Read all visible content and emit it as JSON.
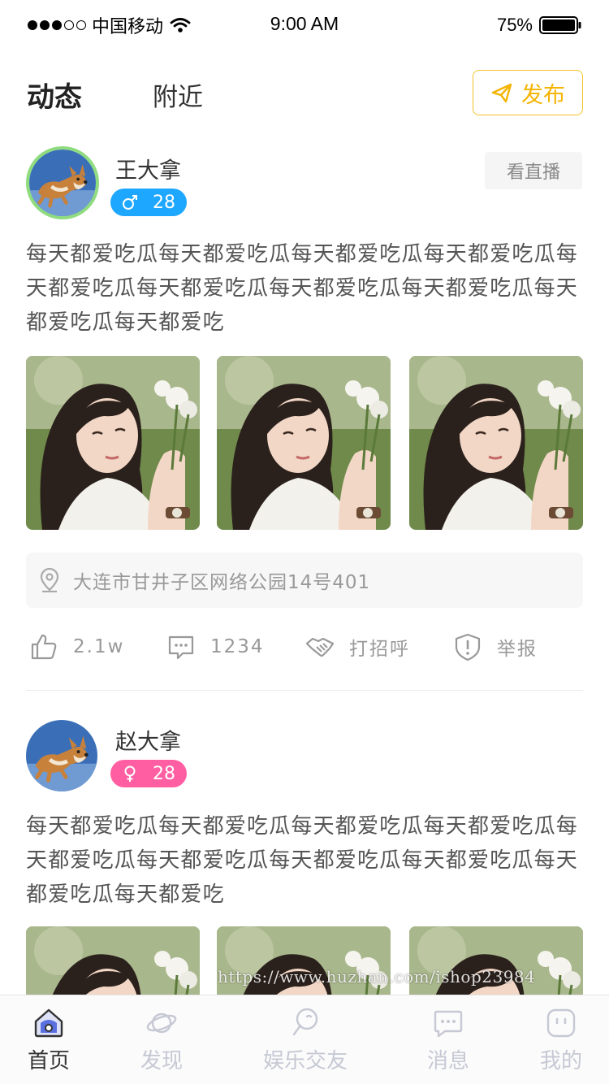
{
  "status_bar": {
    "carrier": "中国移动",
    "time": "9:00 AM",
    "battery": "75%",
    "signal_full": 3,
    "signal_total": 5
  },
  "header": {
    "tabs": [
      "动态",
      "附近"
    ],
    "publish_label": "发布"
  },
  "colors": {
    "accent": "#f5c22e",
    "male": "#1ea7ff",
    "female": "#ff5fa2",
    "ring": "#8fdc7f",
    "tab_active": "#333333",
    "tab_inactive": "#c6c8d4"
  },
  "posts": [
    {
      "user": "王大拿",
      "gender_icon": "male-icon",
      "age": "28",
      "live_label": "看直播",
      "text": "每天都爱吃瓜每天都爱吃瓜每天都爱吃瓜每天都爱吃瓜每天都爱吃瓜每天都爱吃瓜每天都爱吃瓜每天都爱吃瓜每天都爱吃瓜每天都爱吃",
      "location": "大连市甘井子区网络公园14号401",
      "likes": "2.1w",
      "comments": "1234",
      "greet_label": "打招呼",
      "report_label": "举报"
    },
    {
      "user": "赵大拿",
      "gender_icon": "female-icon",
      "age": "28",
      "text": "每天都爱吃瓜每天都爱吃瓜每天都爱吃瓜每天都爱吃瓜每天都爱吃瓜每天都爱吃瓜每天都爱吃瓜每天都爱吃瓜每天都爱吃瓜每天都爱吃"
    }
  ],
  "watermark": "https://www.huzhan.com/ishop23984",
  "tab_bar": [
    {
      "label": "首页",
      "icon": "home-icon"
    },
    {
      "label": "发现",
      "icon": "planet-icon"
    },
    {
      "label": "娱乐交友",
      "icon": "balloon-icon"
    },
    {
      "label": "消息",
      "icon": "message-icon"
    },
    {
      "label": "我的",
      "icon": "profile-icon"
    }
  ]
}
